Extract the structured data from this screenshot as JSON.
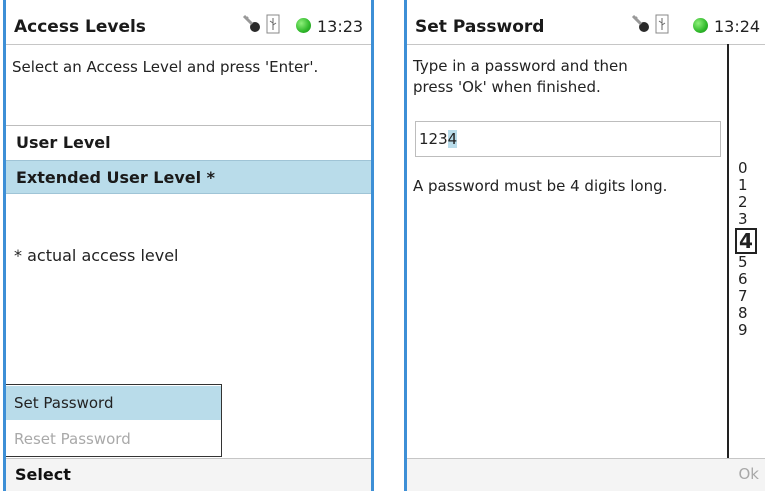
{
  "screen1": {
    "title": "Access Levels",
    "time": "13:23",
    "prompt": "Select an Access Level and press 'Enter'.",
    "levels": [
      {
        "label": "User Level",
        "selected": false
      },
      {
        "label": "Extended User Level *",
        "selected": true
      }
    ],
    "note": "* actual access level",
    "popup": [
      {
        "label": "Set Password",
        "highlighted": true,
        "disabled": false
      },
      {
        "label": "Reset Password",
        "highlighted": false,
        "disabled": true
      }
    ],
    "softkey_left": "Select"
  },
  "screen2": {
    "title": "Set Password",
    "time": "13:24",
    "prompt_line1": "Type in a password and then",
    "prompt_line2": "press 'Ok' when finished.",
    "password_entered": "123",
    "password_cursor": "4",
    "hint": "A password must be 4 digits long.",
    "digits_before": [
      "0",
      "1",
      "2",
      "3"
    ],
    "digit_selected": "4",
    "digits_after": [
      "5",
      "6",
      "7",
      "8",
      "9"
    ],
    "softkey_right": "Ok"
  },
  "icons": {
    "key": "key-icon",
    "usb": "usb-icon",
    "status_led": "status-led-icon"
  },
  "colors": {
    "frame": "#3d8fd6",
    "selection": "#b9dcea",
    "led": "#2fb82a",
    "disabled_text": "#a9a9a9"
  }
}
